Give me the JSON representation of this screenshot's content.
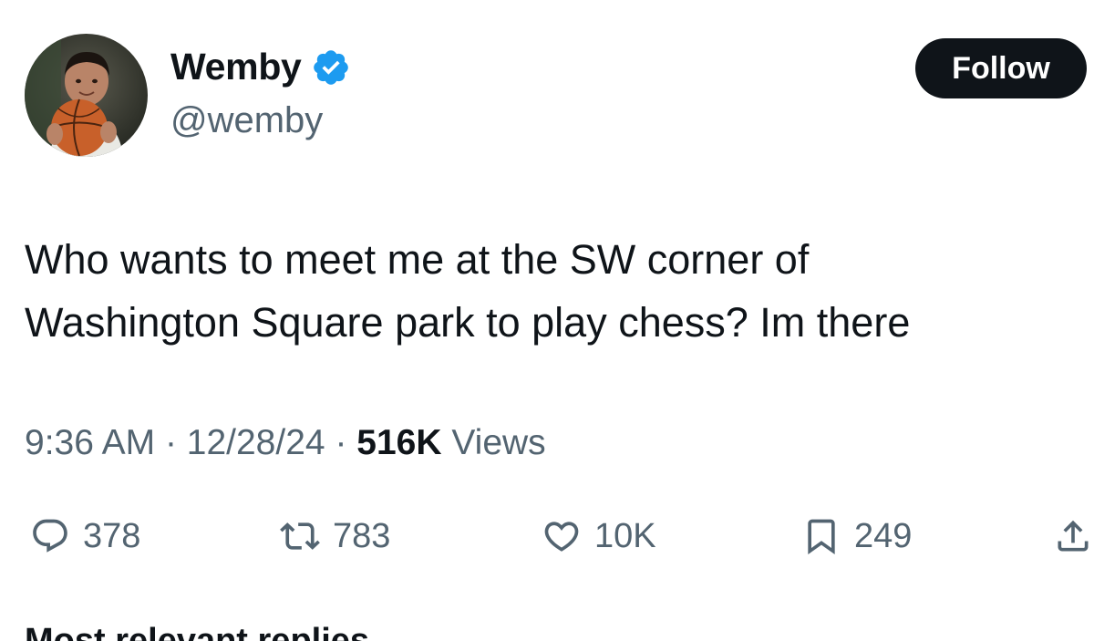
{
  "author": {
    "display_name": "Wemby",
    "handle": "@wemby",
    "verified": true,
    "avatar_description": "avatar-photo"
  },
  "follow_button": {
    "label": "Follow"
  },
  "tweet": {
    "text_lines": [
      "Who wants to meet me at the SW corner of",
      "Washington Square park to play chess? Im there"
    ],
    "time": "9:36 AM",
    "separator": "·",
    "date": "12/28/24",
    "views_count": "516K",
    "views_label": "Views"
  },
  "actions": {
    "reply_count": "378",
    "retweet_count": "783",
    "like_count": "10K",
    "bookmark_count": "249"
  },
  "replies_heading": "Most relevant replies",
  "colors": {
    "text_primary": "#0f1419",
    "text_secondary": "#536471",
    "verified_blue": "#1d9bf0",
    "follow_bg": "#0f1419"
  },
  "icons": {
    "verified": "verified-badge-icon",
    "reply": "reply-bubble-icon",
    "retweet": "retweet-arrows-icon",
    "like": "heart-icon",
    "bookmark": "bookmark-icon",
    "share": "share-upload-icon"
  }
}
